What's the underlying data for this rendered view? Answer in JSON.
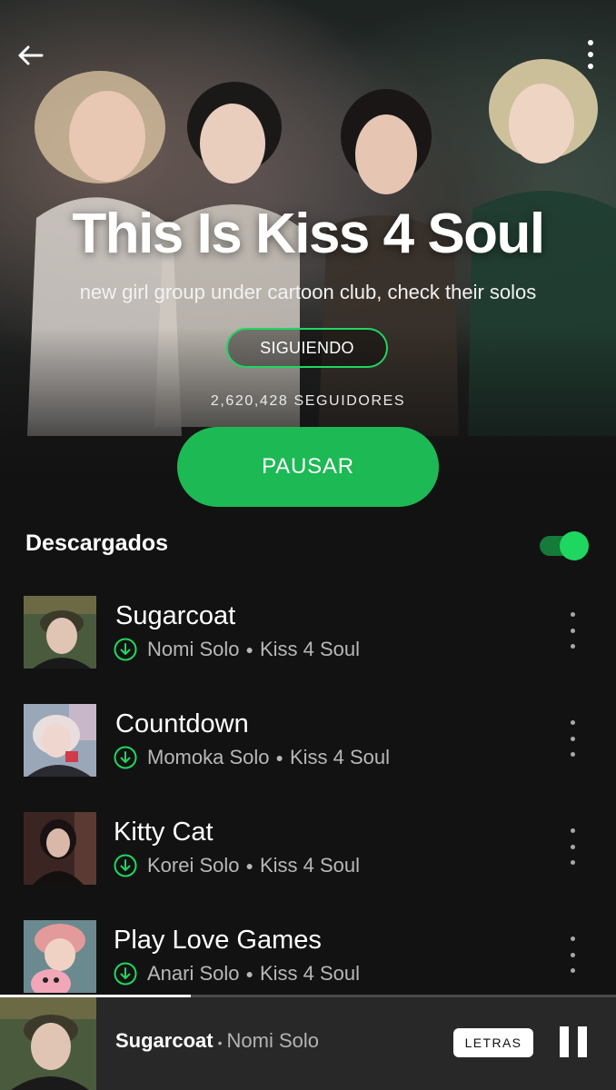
{
  "header": {
    "back_icon": "arrow-left-icon",
    "more_icon": "more-vertical-icon"
  },
  "playlist": {
    "title": "This Is Kiss 4 Soul",
    "description": "new girl group under cartoon club, check their solos",
    "follow_label": "SIGUIENDO",
    "followers": "2,620,428 SEGUIDORES",
    "play_label": "PAUSAR"
  },
  "downloads": {
    "label": "Descargados",
    "enabled": true
  },
  "tracks": [
    {
      "title": "Sugarcoat",
      "artist": "Nomi Solo",
      "album": "Kiss 4 Soul",
      "downloaded": true
    },
    {
      "title": "Countdown",
      "artist": "Momoka Solo",
      "album": "Kiss 4 Soul",
      "downloaded": true
    },
    {
      "title": "Kitty Cat",
      "artist": "Korei Solo",
      "album": "Kiss 4 Soul",
      "downloaded": true
    },
    {
      "title": "Play Love Games",
      "artist": "Anari Solo",
      "album": "Kiss 4 Soul",
      "downloaded": true
    }
  ],
  "now_playing": {
    "title": "Sugarcoat",
    "separator": "•",
    "artist": "Nomi Solo",
    "lyrics_label": "LETRAS",
    "progress": 0.31
  },
  "colors": {
    "accent": "#1db954",
    "accent_bright": "#1ed760",
    "background": "#121212",
    "player_bar": "#282828"
  }
}
